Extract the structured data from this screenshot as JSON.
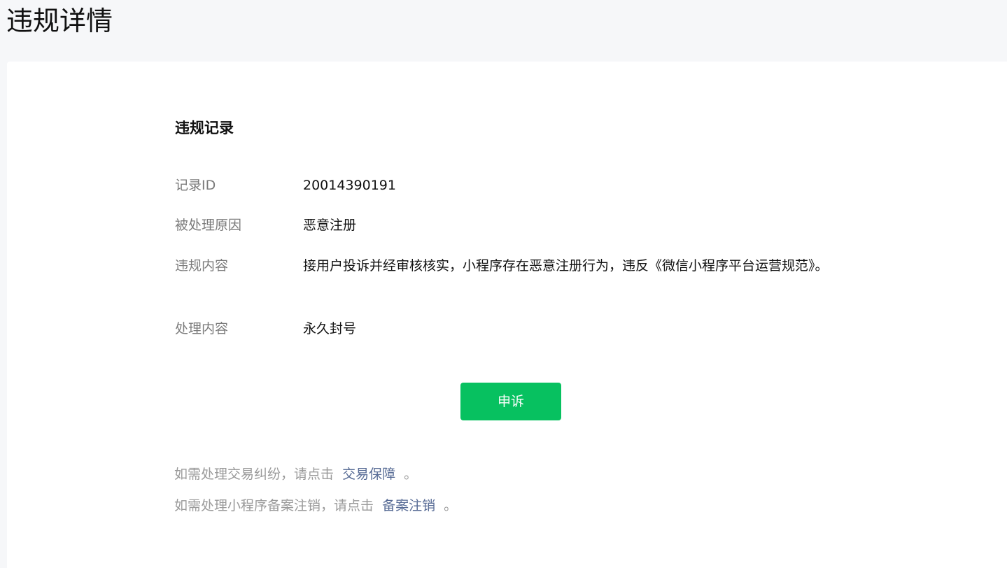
{
  "page": {
    "title": "违规详情"
  },
  "record": {
    "section_title": "违规记录",
    "fields": [
      {
        "label": "记录ID",
        "value": "20014390191"
      },
      {
        "label": "被处理原因",
        "value": "恶意注册"
      },
      {
        "label": "违规内容",
        "value": "接用户投诉并经审核核实，小程序存在恶意注册行为，违反《微信小程序平台运营规范》。"
      },
      {
        "label": "处理内容",
        "value": "永久封号"
      }
    ]
  },
  "actions": {
    "appeal_label": "申诉",
    "appeal_color": "#07c160"
  },
  "footer": {
    "line1_prefix": "如需处理交易纠纷，请点击",
    "line1_link": "交易保障",
    "line1_suffix": "。",
    "line2_prefix": "如需处理小程序备案注销，请点击",
    "line2_link": "备案注销",
    "line2_suffix": "。",
    "link_color": "#576b95"
  }
}
